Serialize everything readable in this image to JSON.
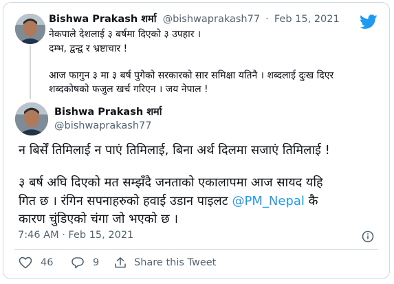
{
  "quoted": {
    "name": "Bishwa Prakash शर्मा",
    "handle": "@bishwaprakash77",
    "separator": "·",
    "date": "Feb 15, 2021",
    "lines": [
      "नेकपाले देशलाई ३ बर्षमा दिएको ३ उपहार ।",
      "दम्भ, द्वन्द्व र भ्रष्टाचार !",
      "आज फागुन ३ मा ३ बर्ष पुगेको सरकारको सार समिक्षा यतिनै । शब्दलाई दुःख दिएर",
      "शब्दकोषको फजुल खर्च गरिएन । जय नेपाल !"
    ]
  },
  "tweet": {
    "name": "Bishwa Prakash शर्मा",
    "handle": "@bishwaprakash77",
    "line1": "न बिर्सें तिमिलाई न पाएं तिमिलाई, बिना अर्थ दिलमा सजाएं तिमिलाई !",
    "line2": "३ बर्ष अघि दिएको मत सम्झँदै जनताको एकालापमा आज सायद यहि",
    "line3_prefix": "गित छ । रंगिन सपनाहरुको हवाई उडान पाइलट ",
    "mention": "@PM_Nepal",
    "line3_suffix": " कै",
    "line4": "कारण चुंडिएको चंगा जो भएको छ ।",
    "timestamp": "7:46 AM · Feb 15, 2021"
  },
  "actions": {
    "likes": "46",
    "replies": "9",
    "share_label": "Share this Tweet"
  },
  "colors": {
    "twitter_blue": "#1d9bf0",
    "text": "#0f1419",
    "muted": "#536471",
    "border": "#cfd9de"
  }
}
